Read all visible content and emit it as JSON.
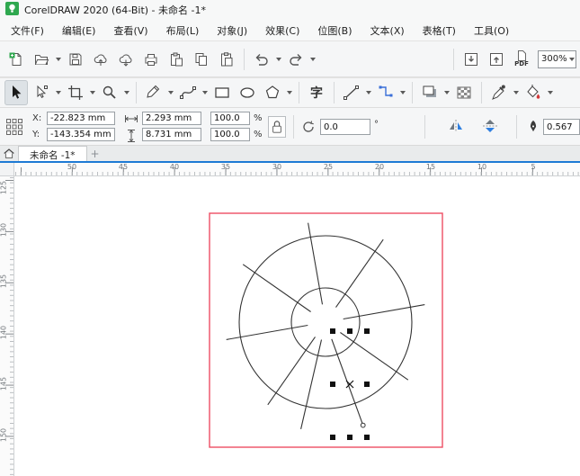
{
  "window": {
    "title": "CorelDRAW 2020 (64-Bit) - 未命名 -1*"
  },
  "menu_bar": {
    "items": [
      "文件(F)",
      "编辑(E)",
      "查看(V)",
      "布局(L)",
      "对象(J)",
      "效果(C)",
      "位图(B)",
      "文本(X)",
      "表格(T)",
      "工具(O)"
    ]
  },
  "standard_toolbar": {
    "zoom_level": "300%",
    "pdf_label": "PDF",
    "icons": [
      "new-document",
      "open",
      "save",
      "cloud-upload",
      "cloud-download",
      "print",
      "paste-special",
      "copy",
      "paste",
      "undo",
      "redo",
      "import",
      "export",
      "publish-to-pdf",
      "zoom-levels"
    ]
  },
  "toolbox": {
    "text_tool_label": "字",
    "tools": [
      "pick",
      "shape-edit",
      "crop",
      "zoom",
      "freehand",
      "bezier",
      "rectangle",
      "ellipse",
      "polygon",
      "text",
      "two-point-line",
      "connector",
      "drop-shadow",
      "transparency",
      "color-eyedropper",
      "interactive-fill"
    ]
  },
  "property_bar": {
    "x_label": "X:",
    "y_label": "Y:",
    "x_value": "-22.823 mm",
    "y_value": "-143.354 mm",
    "width_value": "2.293 mm",
    "height_value": "8.731 mm",
    "scale_h_value": "100.0",
    "scale_v_value": "100.0",
    "percent_label": "%",
    "rotation_value": "0.0",
    "degree_label": "°",
    "outline_width_value": "0.567"
  },
  "tab_bar": {
    "active_tab": "未命名 -1*",
    "new_tab_label": "+"
  },
  "rulers": {
    "horizontal_labels": [
      "50",
      "45",
      "40",
      "35",
      "30",
      "25",
      "20",
      "15",
      "10",
      "5"
    ],
    "vertical_labels": [
      "125",
      "130",
      "135",
      "140",
      "145",
      "150"
    ]
  },
  "colors": {
    "accent_blue": "#1e7ad4",
    "page_border": "#ee4e63",
    "selection_handle": "#111111"
  }
}
